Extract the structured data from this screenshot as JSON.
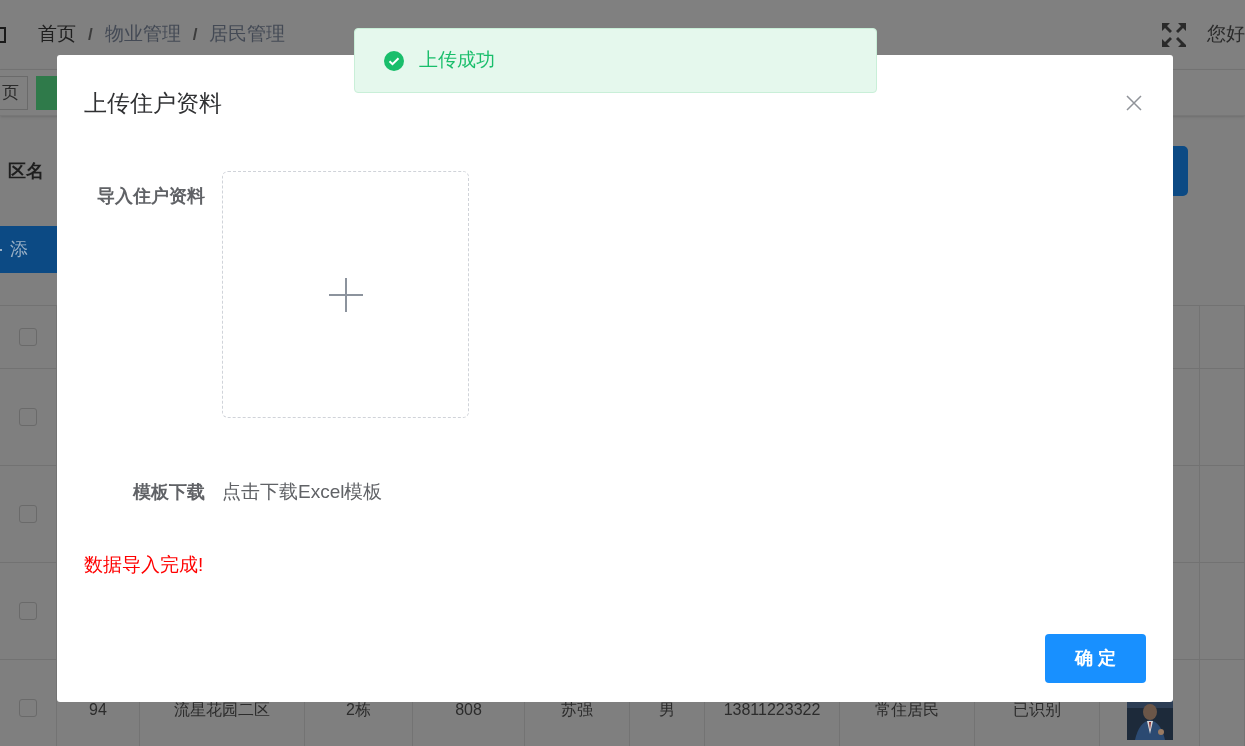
{
  "header": {
    "breadcrumb": [
      "首页",
      "/",
      "物业管理",
      "/",
      "居民管理"
    ],
    "greeting": "您好"
  },
  "tags": [
    {
      "label": "页",
      "selected": false
    },
    {
      "selected": true
    }
  ],
  "filter": {
    "label": "区名"
  },
  "add_button": {
    "label": "添"
  },
  "table": {
    "header_checked": false,
    "rows": [
      {
        "checked": false
      },
      {
        "checked": false
      },
      {
        "checked": false
      },
      {
        "checked": false,
        "cells": [
          "94",
          "流星花园二区",
          "2栋",
          "808",
          "苏强",
          "男",
          "13811223322",
          "常住居民",
          "已识别"
        ]
      }
    ]
  },
  "dialog": {
    "title": "上传住户资料",
    "upload_label": "导入住户资料",
    "template_label": "模板下载",
    "template_link": "点击下载Excel模板",
    "message": "数据导入完成!",
    "confirm_button": "确 定"
  },
  "toast": {
    "kind": "success",
    "text": "上传成功"
  }
}
